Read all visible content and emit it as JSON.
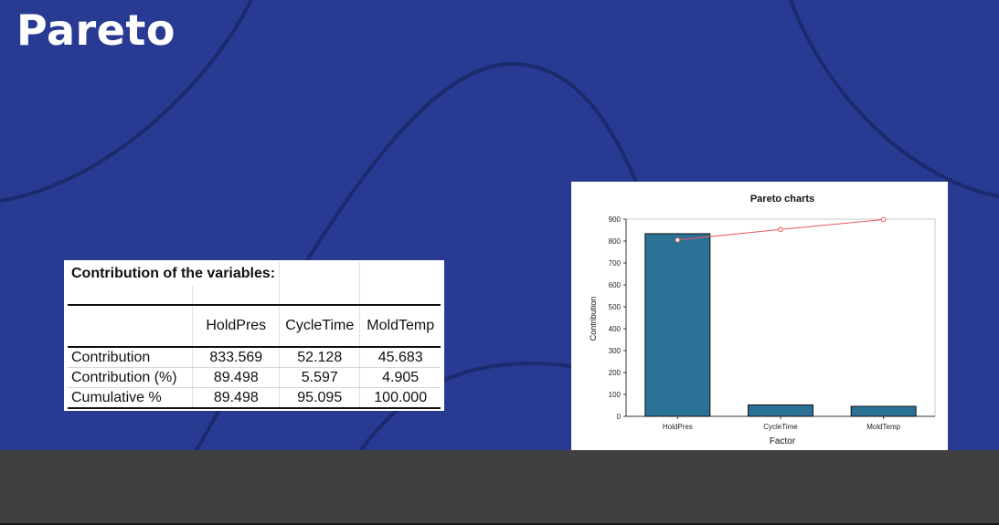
{
  "slide": {
    "title": "Pareto"
  },
  "table": {
    "title": "Contribution of the variables:",
    "columns": [
      "HoldPres",
      "CycleTime",
      "MoldTemp"
    ],
    "rows": [
      {
        "label": "Contribution",
        "values": [
          "833.569",
          "52.128",
          "45.683"
        ]
      },
      {
        "label": "Contribution (%)",
        "values": [
          "89.498",
          "5.597",
          "4.905"
        ]
      },
      {
        "label": "Cumulative %",
        "values": [
          "89.498",
          "95.095",
          "100.000"
        ]
      }
    ]
  },
  "colors": {
    "background": "#283a92",
    "curve": "#1c2a6e",
    "band": "#404040",
    "bar": "#2a7196",
    "bar_outline": "#111111",
    "line": "#e85a5a"
  },
  "chart_data": {
    "type": "bar",
    "title": "Pareto charts",
    "xlabel": "Factor",
    "ylabel": "Contribution",
    "categories": [
      "HoldPres",
      "CycleTime",
      "MoldTemp"
    ],
    "series": [
      {
        "type": "bar",
        "values": [
          833.569,
          52.128,
          45.683
        ]
      },
      {
        "type": "line",
        "values": [
          805,
          853,
          898
        ]
      }
    ],
    "ylim": [
      0,
      900
    ],
    "yticks": [
      0,
      100,
      200,
      300,
      400,
      500,
      600,
      700,
      800,
      900
    ],
    "grid": false,
    "legend": "none"
  }
}
